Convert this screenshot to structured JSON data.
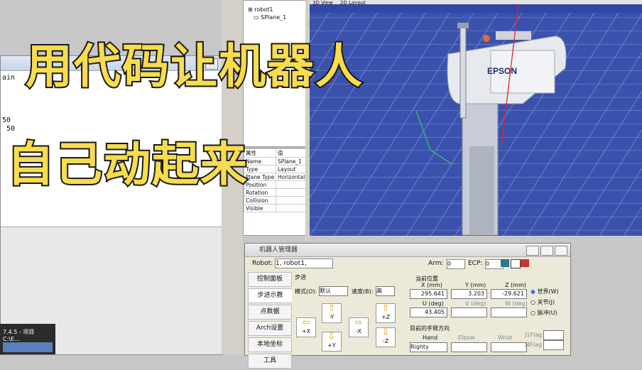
{
  "overlay": {
    "line1": "用代码让机器人",
    "line2": "自己动起来"
  },
  "editor": {
    "close_glyph": "✕",
    "code_lines": [
      "ain",
      "",
      "",
      "",
      "",
      "50",
      " 50"
    ]
  },
  "tree": {
    "items": [
      "robot1",
      "SPlane_1"
    ]
  },
  "viewport": {
    "tabs": [
      "3D View",
      "2D Layout"
    ],
    "brand": "EPSON"
  },
  "props": {
    "header": [
      "属性",
      "值"
    ],
    "rows": [
      [
        "Name",
        "SPlane_1"
      ],
      [
        "Type",
        "Layout"
      ],
      [
        "Plane Type",
        "Horizontal"
      ],
      [
        "Position",
        ""
      ],
      [
        "Rotation",
        ""
      ],
      [
        "Collision",
        ""
      ],
      [
        "Visible",
        ""
      ]
    ]
  },
  "robot_manager": {
    "title": "机器人管理器",
    "robot_label": "Robot:",
    "robot_value": "1, robot1,",
    "arm_label": "Arm:",
    "arm_value": "0",
    "ecp_label": "ECP:",
    "ecp_value": "0",
    "sidebar": [
      "控制面板",
      "步进示教",
      "点数据",
      "Arch设置",
      "本地坐标",
      "工具"
    ],
    "step_group": "步进",
    "mode_label": "模式(O):",
    "mode_value": "默认",
    "speed_label": "速度(B):",
    "speed_value": "高",
    "jog": {
      "xp": "+X",
      "ym": "-Y",
      "xm": "-X",
      "zm": "-Z",
      "yp": "+Y",
      "zp": "+Z"
    },
    "coords_group": "当前位置",
    "x_label": "X (mm)",
    "x_value": "295.641",
    "y_label": "Y (mm)",
    "y_value": "3.203",
    "z_label": "Z (mm)",
    "z_value": "-29.621",
    "u_label": "U (deg)",
    "u_value": "43.405",
    "v_label": "V (deg)",
    "w_label": "W (deg)",
    "frames": [
      "世界(W)",
      "关节(J)",
      "脉冲(U)"
    ],
    "hand_group": "目前的手臂方向",
    "hand_label": "Hand",
    "hand_value": "Righty",
    "elbow_label": "Elbow",
    "wrist_label": "Wrist",
    "j1flag": "J1Flag",
    "j4flag": "J4Flag"
  },
  "taskbar": {
    "text": "7.4.5 - 项目 C:\\E..."
  }
}
